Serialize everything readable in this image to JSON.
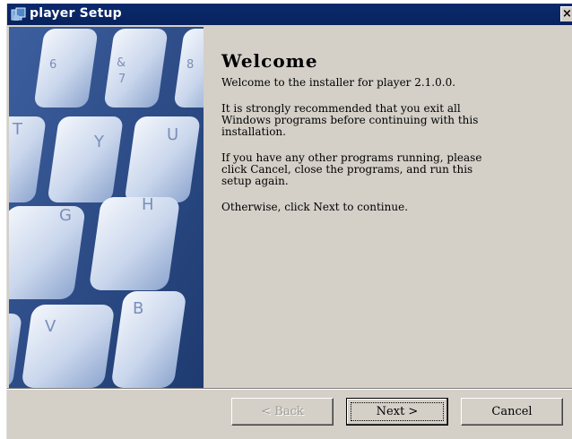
{
  "window": {
    "title": "player Setup",
    "close_glyph": "×"
  },
  "content": {
    "heading": "Welcome",
    "paragraphs": [
      "Welcome to the installer for player 2.1.0.0.",
      "It is strongly recommended that you exit all\nWindows programs before continuing with this\ninstallation.",
      "If you have any other programs running, please\nclick Cancel, close the programs, and run this\nsetup again.",
      "Otherwise, click Next to continue."
    ]
  },
  "buttons": {
    "back": "< Back",
    "next": "Next >",
    "cancel": "Cancel"
  },
  "banner": {
    "description_icon": "keyboard-banner",
    "keys": [
      "6",
      "&",
      "7",
      "8",
      "T",
      "Y",
      "U",
      "G",
      "H",
      "V",
      "B"
    ]
  },
  "colors": {
    "titlebar": "#0a246a",
    "dialog": "#d4d0c8",
    "disabled_text": "#9c9a94"
  }
}
